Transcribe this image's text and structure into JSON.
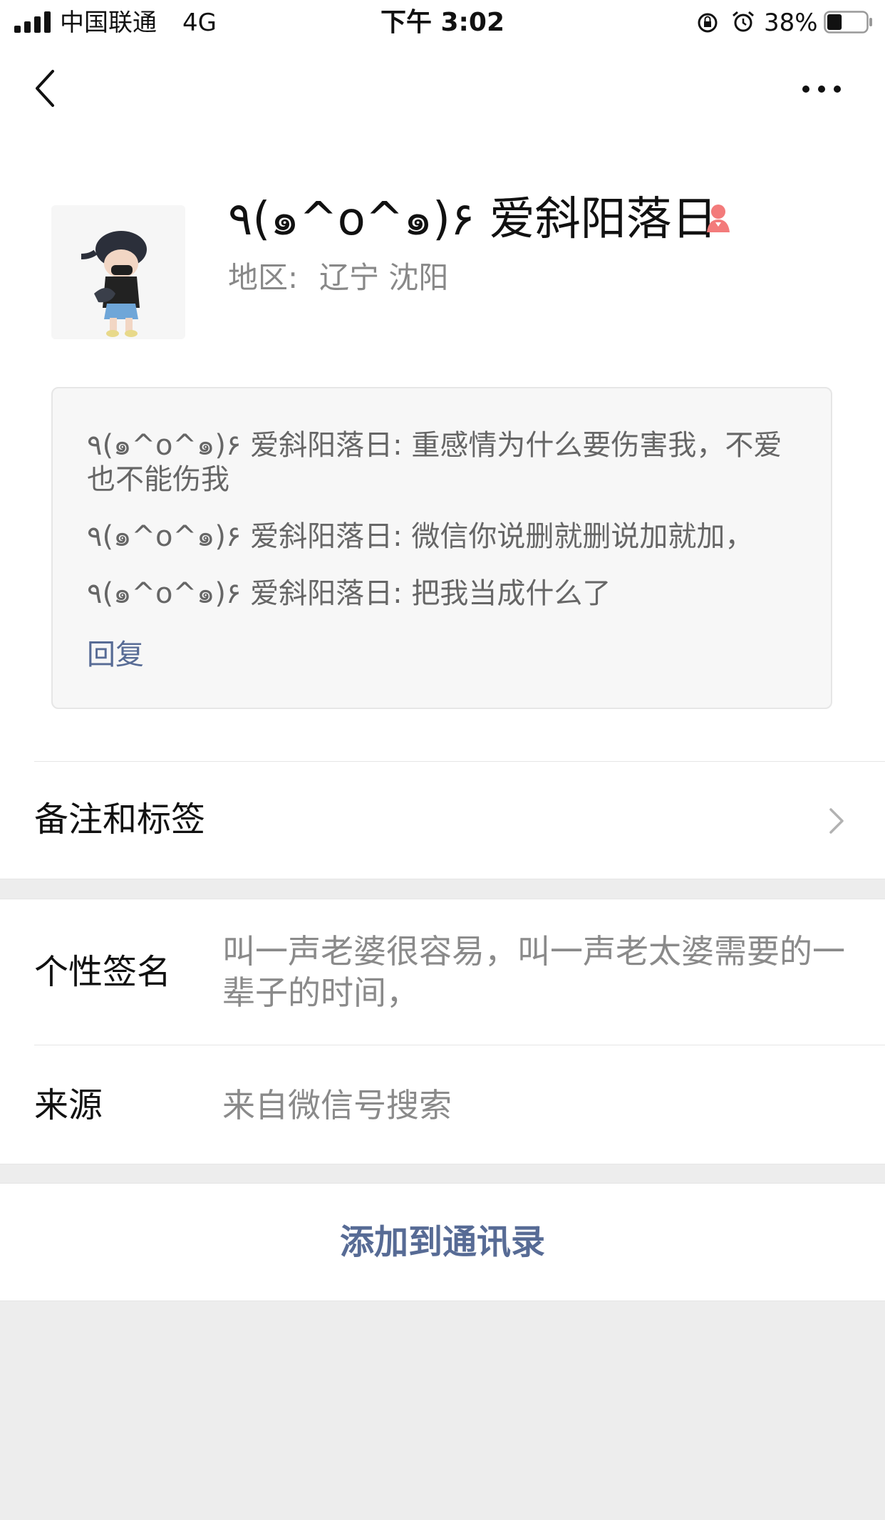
{
  "status_bar": {
    "carrier": "中国联通",
    "network": "4G",
    "time": "下午 3:02",
    "battery_percent": "38%",
    "battery_level": 0.38
  },
  "nav": {
    "back_icon": "chevron-left-icon",
    "more_icon": "ellipsis-icon"
  },
  "profile": {
    "nickname": "٩(๑^o^๑)۶ 爱斜阳落日",
    "gender_icon": "female-icon",
    "gender_color": "#f37b7b",
    "region_label": "地区:",
    "region_value": "辽宁 沈阳"
  },
  "messages": {
    "items": [
      "٩(๑^o^๑)۶ 爱斜阳落日: 重感情为什么要伤害我，不爱也不能伤我",
      "٩(๑^o^๑)۶ 爱斜阳落日: 微信你说删就删说加就加，",
      "٩(๑^o^๑)۶ 爱斜阳落日: 把我当成什么了"
    ],
    "reply_label": "回复"
  },
  "rows": {
    "remarks_label": "备注和标签",
    "signature_label": "个性签名",
    "signature_value": "叫一声老婆很容易，叫一声老太婆需要的一辈子的时间，",
    "source_label": "来源",
    "source_value": "来自微信号搜索"
  },
  "actions": {
    "add_contact_label": "添加到通讯录"
  },
  "colors": {
    "link": "#576b95",
    "background": "#ededed"
  }
}
